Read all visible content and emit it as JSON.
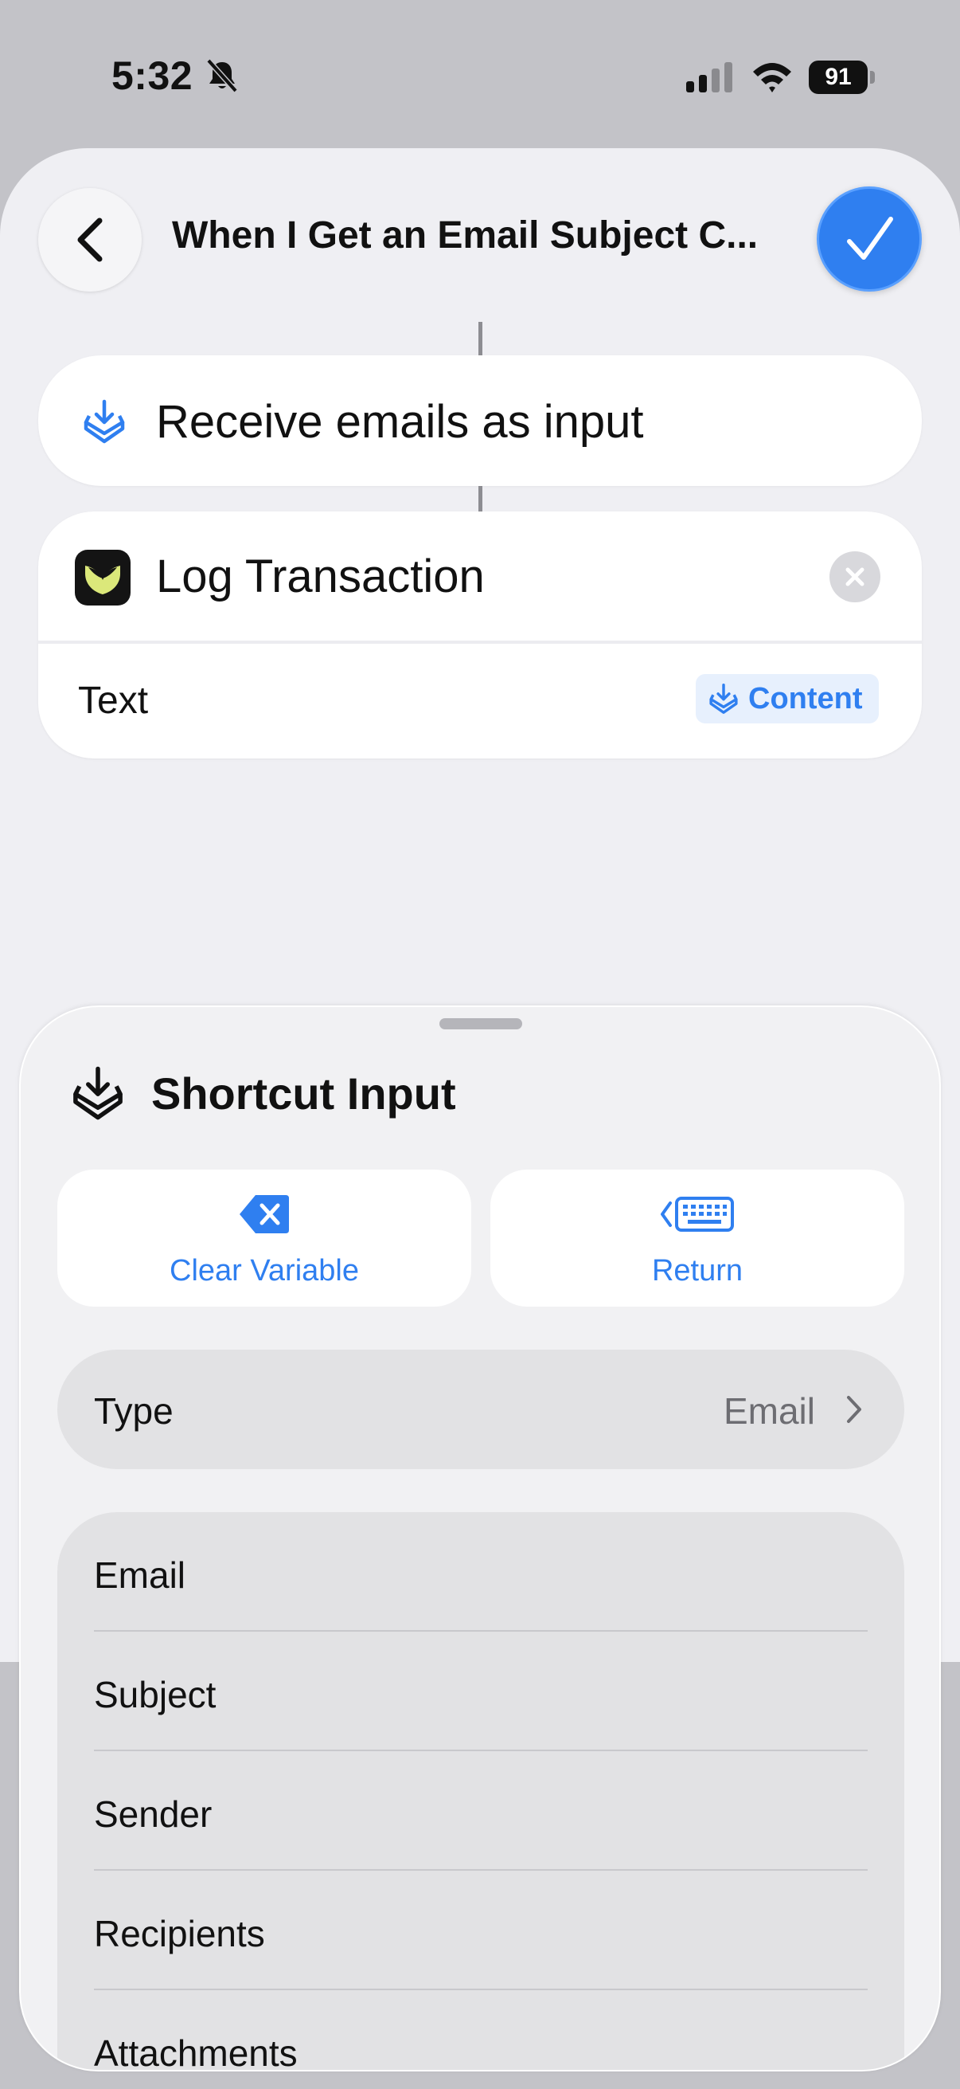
{
  "status_bar": {
    "time": "5:32",
    "battery": "91"
  },
  "editor": {
    "title": "When I Get an Email Subject C...",
    "receive_action": "Receive emails as input",
    "log_action": "Log Transaction",
    "param_label": "Text",
    "param_token": "Content"
  },
  "sheet": {
    "title": "Shortcut Input",
    "clear_label": "Clear Variable",
    "return_label": "Return",
    "type_label": "Type",
    "type_value": "Email",
    "properties": [
      "Email",
      "Subject",
      "Sender",
      "Recipients",
      "Attachments"
    ]
  },
  "colors": {
    "accent": "#2f7ff0",
    "sheet_bg": "#f1f1f3",
    "row_bg": "#e2e2e4"
  }
}
